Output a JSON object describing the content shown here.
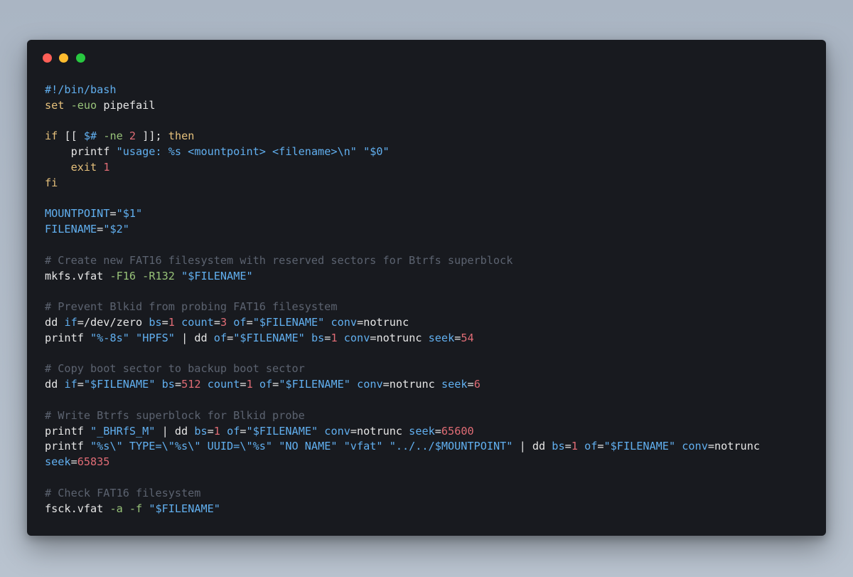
{
  "window": {
    "controls": [
      {
        "name": "close-button",
        "color": "#ff5f57"
      },
      {
        "name": "minimize-button",
        "color": "#febc2e"
      },
      {
        "name": "maximize-button",
        "color": "#28c840"
      }
    ]
  },
  "code": {
    "language": "bash",
    "lines": [
      [
        [
          "shebang",
          "#!/bin/bash"
        ]
      ],
      [
        [
          "keyword",
          "set"
        ],
        [
          "plain",
          " "
        ],
        [
          "option",
          "-euo"
        ],
        [
          "plain",
          " pipefail"
        ]
      ],
      [],
      [
        [
          "keyword",
          "if"
        ],
        [
          "plain",
          " [[ "
        ],
        [
          "variable",
          "$#"
        ],
        [
          "plain",
          " "
        ],
        [
          "option",
          "-ne"
        ],
        [
          "plain",
          " "
        ],
        [
          "number",
          "2"
        ],
        [
          "plain",
          " ]]; "
        ],
        [
          "keyword",
          "then"
        ]
      ],
      [
        [
          "plain",
          "    printf "
        ],
        [
          "string",
          "\"usage: %s <mountpoint> <filename>\\n\""
        ],
        [
          "plain",
          " "
        ],
        [
          "string",
          "\"$0\""
        ]
      ],
      [
        [
          "plain",
          "    "
        ],
        [
          "keyword",
          "exit"
        ],
        [
          "plain",
          " "
        ],
        [
          "number",
          "1"
        ]
      ],
      [
        [
          "keyword",
          "fi"
        ]
      ],
      [],
      [
        [
          "variable",
          "MOUNTPOINT"
        ],
        [
          "plain",
          "="
        ],
        [
          "string",
          "\"$1\""
        ]
      ],
      [
        [
          "variable",
          "FILENAME"
        ],
        [
          "plain",
          "="
        ],
        [
          "string",
          "\"$2\""
        ]
      ],
      [],
      [
        [
          "comment",
          "# Create new FAT16 filesystem with reserved sectors for Btrfs superblock"
        ]
      ],
      [
        [
          "plain",
          "mkfs.vfat "
        ],
        [
          "option",
          "-F16"
        ],
        [
          "plain",
          " "
        ],
        [
          "option",
          "-R132"
        ],
        [
          "plain",
          " "
        ],
        [
          "string",
          "\"$FILENAME\""
        ]
      ],
      [],
      [
        [
          "comment",
          "# Prevent Blkid from probing FAT16 filesystem"
        ]
      ],
      [
        [
          "plain",
          "dd "
        ],
        [
          "attr",
          "if"
        ],
        [
          "plain",
          "=/dev/zero "
        ],
        [
          "attr",
          "bs"
        ],
        [
          "plain",
          "="
        ],
        [
          "number",
          "1"
        ],
        [
          "plain",
          " "
        ],
        [
          "attr",
          "count"
        ],
        [
          "plain",
          "="
        ],
        [
          "number",
          "3"
        ],
        [
          "plain",
          " "
        ],
        [
          "attr",
          "of"
        ],
        [
          "plain",
          "="
        ],
        [
          "string",
          "\"$FILENAME\""
        ],
        [
          "plain",
          " "
        ],
        [
          "attr",
          "conv"
        ],
        [
          "plain",
          "=notrunc"
        ]
      ],
      [
        [
          "plain",
          "printf "
        ],
        [
          "string",
          "\"%-8s\""
        ],
        [
          "plain",
          " "
        ],
        [
          "string",
          "\"HPFS\""
        ],
        [
          "plain",
          " | dd "
        ],
        [
          "attr",
          "of"
        ],
        [
          "plain",
          "="
        ],
        [
          "string",
          "\"$FILENAME\""
        ],
        [
          "plain",
          " "
        ],
        [
          "attr",
          "bs"
        ],
        [
          "plain",
          "="
        ],
        [
          "number",
          "1"
        ],
        [
          "plain",
          " "
        ],
        [
          "attr",
          "conv"
        ],
        [
          "plain",
          "=notrunc "
        ],
        [
          "attr",
          "seek"
        ],
        [
          "plain",
          "="
        ],
        [
          "number",
          "54"
        ]
      ],
      [],
      [
        [
          "comment",
          "# Copy boot sector to backup boot sector"
        ]
      ],
      [
        [
          "plain",
          "dd "
        ],
        [
          "attr",
          "if"
        ],
        [
          "plain",
          "="
        ],
        [
          "string",
          "\"$FILENAME\""
        ],
        [
          "plain",
          " "
        ],
        [
          "attr",
          "bs"
        ],
        [
          "plain",
          "="
        ],
        [
          "number",
          "512"
        ],
        [
          "plain",
          " "
        ],
        [
          "attr",
          "count"
        ],
        [
          "plain",
          "="
        ],
        [
          "number",
          "1"
        ],
        [
          "plain",
          " "
        ],
        [
          "attr",
          "of"
        ],
        [
          "plain",
          "="
        ],
        [
          "string",
          "\"$FILENAME\""
        ],
        [
          "plain",
          " "
        ],
        [
          "attr",
          "conv"
        ],
        [
          "plain",
          "=notrunc "
        ],
        [
          "attr",
          "seek"
        ],
        [
          "plain",
          "="
        ],
        [
          "number",
          "6"
        ]
      ],
      [],
      [
        [
          "comment",
          "# Write Btrfs superblock for Blkid probe"
        ]
      ],
      [
        [
          "plain",
          "printf "
        ],
        [
          "string",
          "\"_BHRfS_M\""
        ],
        [
          "plain",
          " | dd "
        ],
        [
          "attr",
          "bs"
        ],
        [
          "plain",
          "="
        ],
        [
          "number",
          "1"
        ],
        [
          "plain",
          " "
        ],
        [
          "attr",
          "of"
        ],
        [
          "plain",
          "="
        ],
        [
          "string",
          "\"$FILENAME\""
        ],
        [
          "plain",
          " "
        ],
        [
          "attr",
          "conv"
        ],
        [
          "plain",
          "=notrunc "
        ],
        [
          "attr",
          "seek"
        ],
        [
          "plain",
          "="
        ],
        [
          "number",
          "65600"
        ]
      ],
      [
        [
          "plain",
          "printf "
        ],
        [
          "string",
          "\"%s\\\" TYPE=\\\"%s\\\" UUID=\\\"%s\""
        ],
        [
          "plain",
          " "
        ],
        [
          "string",
          "\"NO NAME\""
        ],
        [
          "plain",
          " "
        ],
        [
          "string",
          "\"vfat\""
        ],
        [
          "plain",
          " "
        ],
        [
          "string",
          "\"../../$MOUNTPOINT\""
        ],
        [
          "plain",
          " | dd "
        ],
        [
          "attr",
          "bs"
        ],
        [
          "plain",
          "="
        ],
        [
          "number",
          "1"
        ],
        [
          "plain",
          " "
        ],
        [
          "attr",
          "of"
        ],
        [
          "plain",
          "="
        ],
        [
          "string",
          "\"$FILENAME\""
        ],
        [
          "plain",
          " "
        ],
        [
          "attr",
          "conv"
        ],
        [
          "plain",
          "=notrunc"
        ]
      ],
      [
        [
          "attr",
          "seek"
        ],
        [
          "plain",
          "="
        ],
        [
          "number",
          "65835"
        ]
      ],
      [],
      [
        [
          "comment",
          "# Check FAT16 filesystem"
        ]
      ],
      [
        [
          "plain",
          "fsck.vfat "
        ],
        [
          "option",
          "-a"
        ],
        [
          "plain",
          " "
        ],
        [
          "option",
          "-f"
        ],
        [
          "plain",
          " "
        ],
        [
          "string",
          "\"$FILENAME\""
        ]
      ]
    ]
  }
}
